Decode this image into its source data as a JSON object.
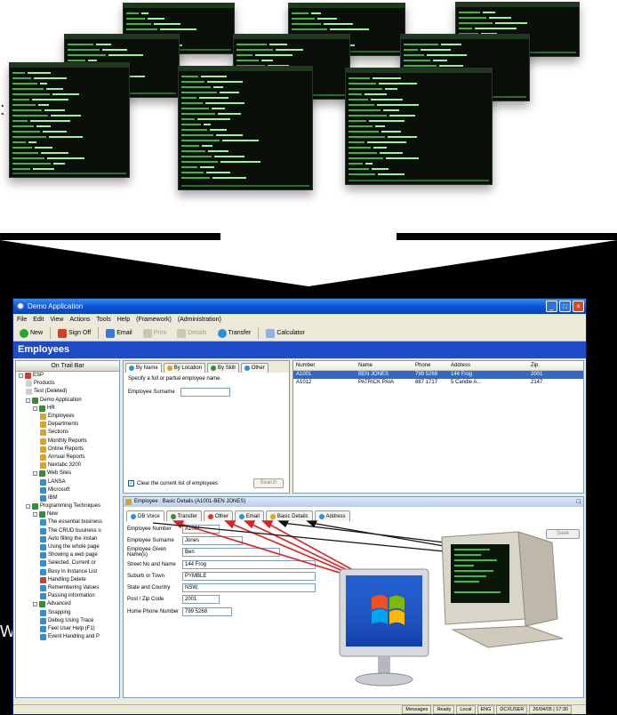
{
  "stray_glyphs": {
    "colon": ":",
    "w": "W"
  },
  "terminal_screens": [
    {
      "name": "terminal-screen-1"
    },
    {
      "name": "terminal-screen-2"
    },
    {
      "name": "terminal-screen-3"
    },
    {
      "name": "terminal-screen-4"
    },
    {
      "name": "terminal-screen-5"
    },
    {
      "name": "terminal-screen-6"
    },
    {
      "name": "terminal-screen-7"
    },
    {
      "name": "terminal-screen-8"
    },
    {
      "name": "terminal-screen-9"
    }
  ],
  "window": {
    "title": "Demo Application",
    "menu": [
      "File",
      "Edit",
      "View",
      "Actions",
      "Tools",
      "Help",
      "(Framework)",
      "(Administration)"
    ],
    "toolbar": {
      "new": "New",
      "sign_off": "Sign Off",
      "email": "Email",
      "print": "Print",
      "details": "Details",
      "transfer": "Transfer",
      "calculator": "Calculator"
    },
    "banner": "Employees"
  },
  "tree": {
    "header": "On Trail Bar",
    "items": [
      {
        "label": "ESP",
        "level": 0,
        "icon": "#d63a2e",
        "expander": "-"
      },
      {
        "label": "Products",
        "level": 1,
        "icon": "#cfcfcf"
      },
      {
        "label": "Test (Deleted)",
        "level": 1,
        "icon": "#cfcfcf"
      },
      {
        "label": "Demo Application",
        "level": 1,
        "icon": "#3a8a3a",
        "expander": "-"
      },
      {
        "label": "HR",
        "level": 2,
        "icon": "#3a8a3a",
        "expander": "-"
      },
      {
        "label": "Employees",
        "level": 3,
        "icon": "#e3a21a"
      },
      {
        "label": "Departments",
        "level": 3,
        "icon": "#e3a21a"
      },
      {
        "label": "Sections",
        "level": 3,
        "icon": "#e3a21a"
      },
      {
        "label": "Monthly Reports",
        "level": 3,
        "icon": "#e3a21a"
      },
      {
        "label": "Online Reports",
        "level": 3,
        "icon": "#e3a21a"
      },
      {
        "label": "Annual Reports",
        "level": 3,
        "icon": "#e3a21a"
      },
      {
        "label": "Nextabc 3200",
        "level": 3,
        "icon": "#e3a21a"
      },
      {
        "label": "Web Sites",
        "level": 2,
        "icon": "#3a8a3a",
        "expander": "-"
      },
      {
        "label": "LANSA",
        "level": 3,
        "icon": "#2d8fd6"
      },
      {
        "label": "Microsoft",
        "level": 3,
        "icon": "#2d8fd6"
      },
      {
        "label": "IBM",
        "level": 3,
        "icon": "#2d8fd6"
      },
      {
        "label": "Programming Techniques",
        "level": 1,
        "icon": "#3a8a3a",
        "expander": "-"
      },
      {
        "label": "New",
        "level": 2,
        "icon": "#3a8a3a",
        "expander": "-"
      },
      {
        "label": "The essential business",
        "level": 3,
        "icon": "#2d8fd6"
      },
      {
        "label": "The CRUD business o",
        "level": 3,
        "icon": "#2d8fd6"
      },
      {
        "label": "Auto filling the instan",
        "level": 3,
        "icon": "#2d8fd6"
      },
      {
        "label": "Using the whole page",
        "level": 3,
        "icon": "#2d8fd6"
      },
      {
        "label": "Showing a web page",
        "level": 3,
        "icon": "#2d8fd6"
      },
      {
        "label": "Selected, Current or",
        "level": 3,
        "icon": "#2d8fd6"
      },
      {
        "label": "Busy in Instance List",
        "level": 3,
        "icon": "#2d8fd6"
      },
      {
        "label": "Handling Delete",
        "level": 3,
        "icon": "#d63a2e"
      },
      {
        "label": "Remembering Values",
        "level": 3,
        "icon": "#2d8fd6"
      },
      {
        "label": "Passing information",
        "level": 3,
        "icon": "#2d8fd6"
      },
      {
        "label": "Advanced",
        "level": 2,
        "icon": "#3a8a3a",
        "expander": "-"
      },
      {
        "label": "Snapping",
        "level": 3,
        "icon": "#2d8fd6"
      },
      {
        "label": "Debug Using Trace",
        "level": 3,
        "icon": "#2d8fd6"
      },
      {
        "label": "Feel User Help (F1)",
        "level": 3,
        "icon": "#2d8fd6"
      },
      {
        "label": "Event Handling and P",
        "level": 3,
        "icon": "#2d8fd6"
      }
    ]
  },
  "search_panel": {
    "tabs": [
      {
        "label": "By Name",
        "icon": "#2d8fd6",
        "active": true
      },
      {
        "label": "By Location",
        "icon": "#e3a21a",
        "active": false
      },
      {
        "label": "By Skill",
        "icon": "#3a8a3a",
        "active": false
      },
      {
        "label": "Other",
        "icon": "#2d8fd6",
        "active": false
      }
    ],
    "hint": "Specify a full or partial employee name.",
    "surname_label": "Employee Surname",
    "surname_value": "",
    "clear_label": "Clear the current list of employees",
    "clear_checked": true,
    "search_button": "Search"
  },
  "results": {
    "columns": [
      "Number",
      "Name",
      "Phone",
      "Address",
      "Zip"
    ],
    "rows": [
      {
        "cells": [
          "A1001",
          "BEN JONES",
          "799 5268",
          "144 Frog",
          "2001"
        ],
        "selected": true
      },
      {
        "cells": [
          "A1012",
          "PATRICK PAIA",
          "887 1717",
          "5 Candle A...",
          "2147"
        ],
        "selected": false
      }
    ]
  },
  "detail_panel": {
    "title": "Employee : Basic Details (A1001-BEN JONES)",
    "tabs": [
      {
        "label": "DB Voice",
        "icon": "#2d8fd6",
        "active": true
      },
      {
        "label": "Transfer",
        "icon": "#3a8a3a",
        "active": false
      },
      {
        "label": "Other",
        "icon": "#d63a2e",
        "active": false
      },
      {
        "label": "Email",
        "icon": "#2d8fd6",
        "active": false
      },
      {
        "label": "Basic Details",
        "icon": "#e3a21a",
        "active": false
      },
      {
        "label": "Address",
        "icon": "#2d8fd6",
        "active": false
      }
    ],
    "fields": [
      {
        "label": "Employee Number",
        "value": "A1001",
        "w": 42
      },
      {
        "label": "Employee Surname",
        "value": "Jones",
        "w": 68
      },
      {
        "label": "Employee Given Name(s)",
        "value": "Ben",
        "w": 110
      },
      {
        "label": "Street No and Name",
        "value": "144 Frog",
        "w": 150
      },
      {
        "label": "Suburb or Town",
        "value": "PYMBLE",
        "w": 150
      },
      {
        "label": "State and Country",
        "value": "NSW,",
        "w": 150
      },
      {
        "label": "Post / Zip Code",
        "value": "2001",
        "w": 42
      },
      {
        "label": "Home Phone Number",
        "value": "799 5268",
        "w": 56
      }
    ],
    "save_button": "Save"
  },
  "statusbar": [
    "Messages",
    "Ready",
    "Local",
    "ENG",
    "DCXUSER",
    "26/04/05 | 17:30"
  ],
  "colors": {
    "terminal_text": "#5cd65c",
    "banner": "#1e4cc8",
    "selection": "#316ac5",
    "arrow_red": "#e02020"
  }
}
